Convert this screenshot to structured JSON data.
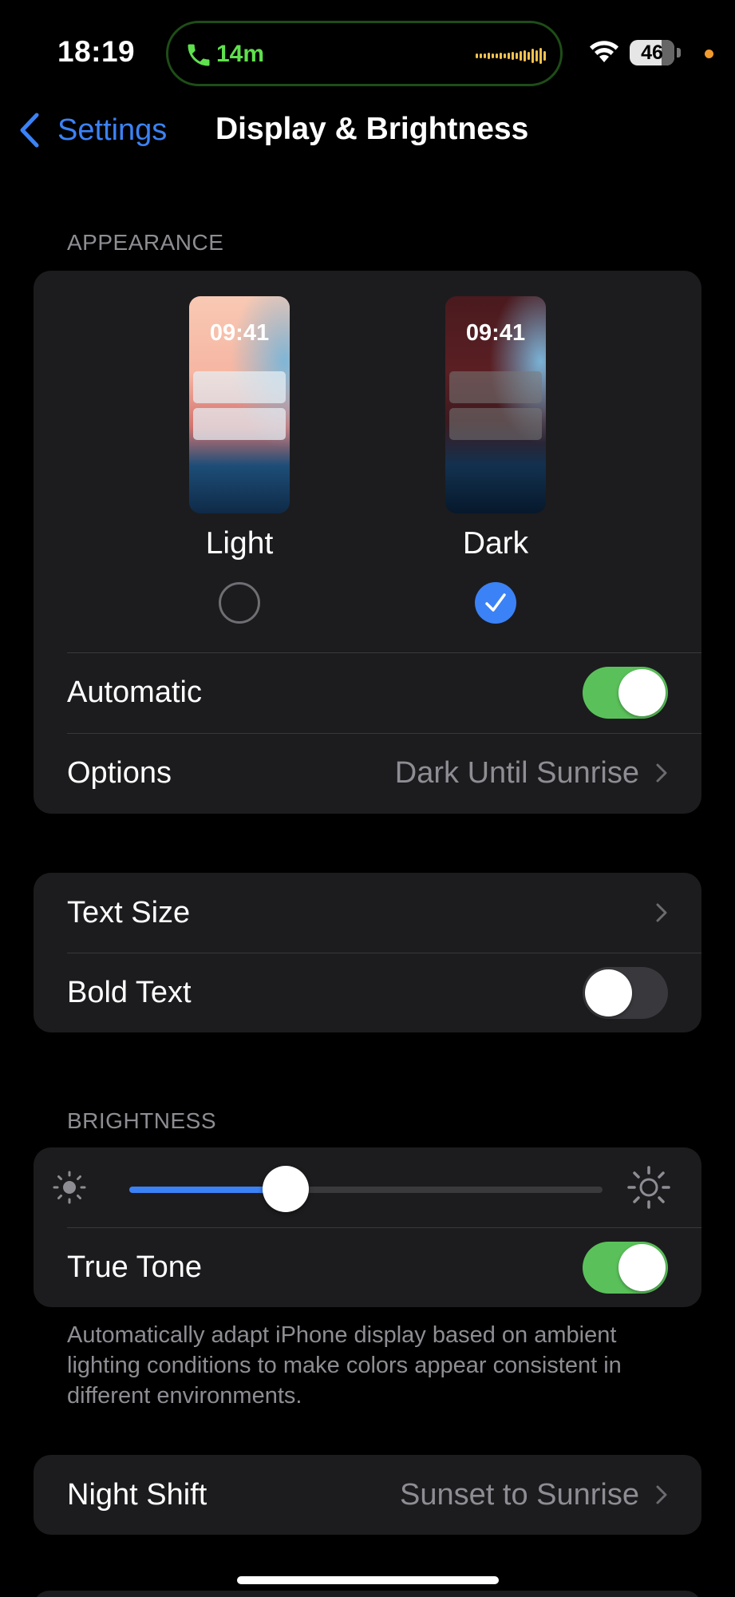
{
  "status_bar": {
    "time": "18:19",
    "call_duration": "14m",
    "battery_level": "46"
  },
  "nav": {
    "back_label": "Settings",
    "title": "Display & Brightness"
  },
  "appearance": {
    "header": "APPEARANCE",
    "preview_time": "09:41",
    "light_label": "Light",
    "dark_label": "Dark",
    "selected": "Dark",
    "automatic_label": "Automatic",
    "automatic_on": true,
    "options_label": "Options",
    "options_value": "Dark Until Sunrise"
  },
  "text": {
    "text_size_label": "Text Size",
    "bold_text_label": "Bold Text",
    "bold_text_on": false
  },
  "brightness": {
    "header": "BRIGHTNESS",
    "level": 0.33,
    "true_tone_label": "True Tone",
    "true_tone_on": true,
    "true_tone_footnote": "Automatically adapt iPhone display based on ambient lighting conditions to make colors appear consistent in different environments."
  },
  "night_shift": {
    "label": "Night Shift",
    "value": "Sunset to Sunrise"
  },
  "colors": {
    "accent": "#3b82f6",
    "toggle_on": "#5ac15a",
    "call_green": "#5fe04d"
  }
}
